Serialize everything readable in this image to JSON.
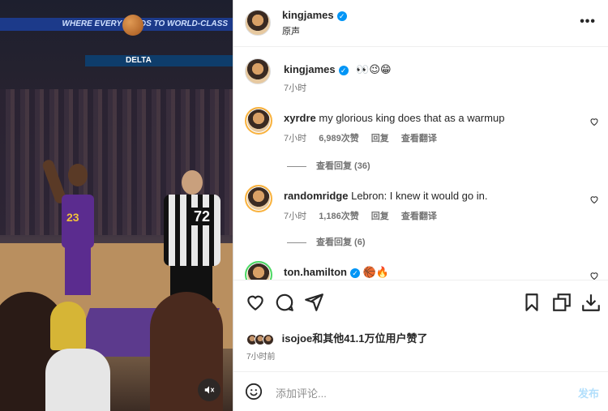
{
  "media": {
    "scoreboard_text": "WHERE EVERY LEADS TO WORLD-CLASS",
    "banner_text": "DELTA",
    "player_number": "23",
    "referee_number": "72",
    "mute_icon": "speaker-muted-icon"
  },
  "header": {
    "username": "kingjames",
    "audio_label": "原声",
    "more_label": "•••"
  },
  "caption": {
    "username": "kingjames",
    "text": "👀😉😁",
    "time": "7小时"
  },
  "comments": [
    {
      "username": "xyrdre",
      "text": "my glorious king does that as a warmup",
      "time": "7小时",
      "likes": "6,989次赞",
      "reply": "回复",
      "translate": "查看翻译",
      "view_replies": "查看回复 (36)"
    },
    {
      "username": "randomridge",
      "text": "Lebron: I knew it would go in.",
      "time": "7小时",
      "likes": "1,186次赞",
      "reply": "回复",
      "translate": "查看翻译",
      "view_replies": "查看回复 (6)"
    },
    {
      "username": "ton.hamilton",
      "text": "🏀🔥"
    }
  ],
  "likes_summary": {
    "username": "isojoe",
    "text": "和其他41.1万位用户赞了",
    "time": "7小时前"
  },
  "composer": {
    "placeholder": "添加评论...",
    "post_label": "发布"
  },
  "colors": {
    "verified": "#0095f6",
    "post_disabled": "#b2dffc",
    "muted_text": "#737373"
  }
}
